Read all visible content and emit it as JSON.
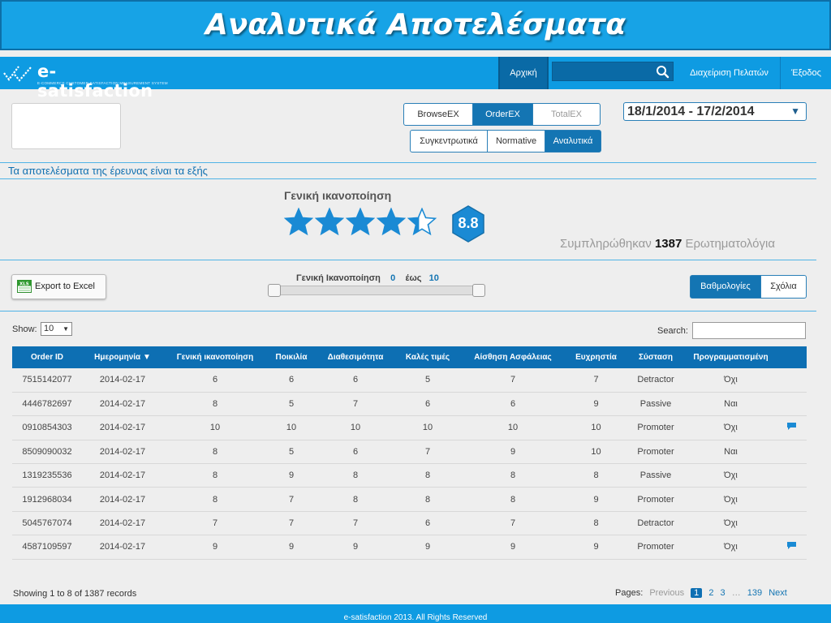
{
  "slide": {
    "title": "Αναλυτικά Αποτελέσματα"
  },
  "navbar": {
    "logo_text": "e-satisfaction",
    "logo_subtitle": "E-COMMERCE CUSTOMER SATISFACTION MEASUREMENT SYSTEM",
    "home": "Αρχική",
    "search_placeholder": "",
    "customers": "Διαχείριση Πελατών",
    "logout": "Έξοδος"
  },
  "filters": {
    "products": [
      {
        "label": "BrowseEX",
        "state": "normal"
      },
      {
        "label": "OrderEX",
        "state": "active"
      },
      {
        "label": "TotalEX",
        "state": "disabled"
      }
    ],
    "views": [
      {
        "label": "Συγκεντρωτικά",
        "state": "normal"
      },
      {
        "label": "Normative",
        "state": "normal"
      },
      {
        "label": "Αναλυτικά",
        "state": "active"
      }
    ],
    "date_range": "18/1/2014 - 17/2/2014"
  },
  "section_title": "Τα αποτελέσματα της έρευνας είναι τα εξής",
  "rating": {
    "title": "Γενική ικανοποίηση",
    "score": "8.8",
    "stars_filled": 4.4,
    "stars_total": 5
  },
  "completed": {
    "prefix": "Συμπληρώθηκαν",
    "count": "1387",
    "suffix": "Ερωτηματολόγια"
  },
  "export_label": "Export to Excel",
  "range": {
    "label": "Γενική Ικανοποίηση",
    "min": "0",
    "connector": "έως",
    "max": "10"
  },
  "toggle": [
    {
      "label": "Βαθμολογίες",
      "state": "active"
    },
    {
      "label": "Σχόλια",
      "state": "normal"
    }
  ],
  "table_controls": {
    "show_label": "Show:",
    "show_value": "10",
    "search_label": "Search:",
    "search_value": ""
  },
  "table": {
    "headers": [
      "Order ID",
      "Ημερομηνία ▼",
      "Γενική ικανοποίηση",
      "Ποικιλία",
      "Διαθεσιμότητα",
      "Καλές τιμές",
      "Αίσθηση Ασφάλειας",
      "Ευχρηστία",
      "Σύσταση",
      "Προγραμματισμένη",
      ""
    ],
    "rows": [
      {
        "cells": [
          "7515142077",
          "2014-02-17",
          "6",
          "6",
          "6",
          "5",
          "7",
          "7",
          "Detractor",
          "Όχι"
        ],
        "comment": false
      },
      {
        "cells": [
          "4446782697",
          "2014-02-17",
          "8",
          "5",
          "7",
          "6",
          "6",
          "9",
          "Passive",
          "Ναι"
        ],
        "comment": false
      },
      {
        "cells": [
          "0910854303",
          "2014-02-17",
          "10",
          "10",
          "10",
          "10",
          "10",
          "10",
          "Promoter",
          "Όχι"
        ],
        "comment": true
      },
      {
        "cells": [
          "8509090032",
          "2014-02-17",
          "8",
          "5",
          "6",
          "7",
          "9",
          "10",
          "Promoter",
          "Ναι"
        ],
        "comment": false
      },
      {
        "cells": [
          "1319235536",
          "2014-02-17",
          "8",
          "9",
          "8",
          "8",
          "8",
          "8",
          "Passive",
          "Όχι"
        ],
        "comment": false
      },
      {
        "cells": [
          "1912968034",
          "2014-02-17",
          "8",
          "7",
          "8",
          "8",
          "8",
          "9",
          "Promoter",
          "Όχι"
        ],
        "comment": false
      },
      {
        "cells": [
          "5045767074",
          "2014-02-17",
          "7",
          "7",
          "7",
          "6",
          "7",
          "8",
          "Detractor",
          "Όχι"
        ],
        "comment": false
      },
      {
        "cells": [
          "4587109597",
          "2014-02-17",
          "9",
          "9",
          "9",
          "9",
          "9",
          "9",
          "Promoter",
          "Όχι"
        ],
        "comment": true
      }
    ]
  },
  "records_info": "Showing 1 to 8  of 1387 records",
  "pagination": {
    "label": "Pages:",
    "previous": "Previous",
    "pages": [
      "1",
      "2",
      "3"
    ],
    "active": "1",
    "ellipsis": "…",
    "last": "139",
    "next": "Next"
  },
  "footer": "e-satisfaction 2013. All Rights Reserved",
  "colors": {
    "primary": "#0e9be2",
    "dark": "#0d6fb3",
    "accent": "#2a7fb7",
    "star": "#1a8ad4"
  },
  "icons": [
    "search-icon",
    "star-icon",
    "hexagon-badge-icon",
    "excel-icon",
    "comment-icon",
    "chevron-down-icon"
  ]
}
